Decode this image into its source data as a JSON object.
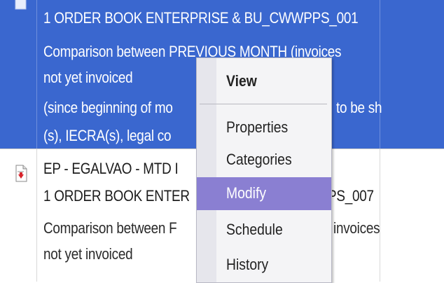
{
  "rows": [
    {
      "selected": true,
      "lines": [
        "1 ORDER BOOK ENTERPRISE & BU_CWWPPS_001",
        "Comparison between PREVIOUS MONTH (invoices",
        " not yet invoiced",
        "(since beginning of mo",
        "to be sh",
        "(s), IECRA(s), legal co"
      ]
    },
    {
      "selected": false,
      "icon": "report-document-icon",
      "lines": [
        "EP - EGALVAO - MTD I",
        "1 ORDER BOOK ENTER",
        "PS_007",
        "Comparison between F",
        "invoices",
        " not yet invoiced"
      ]
    }
  ],
  "context_menu": {
    "items": [
      {
        "label": "View",
        "bold": true
      },
      {
        "label": "Properties"
      },
      {
        "label": "Categories"
      },
      {
        "label": "Modify",
        "highlighted": true
      },
      {
        "label": "Schedule"
      },
      {
        "label": "History"
      }
    ]
  },
  "colors": {
    "selection": "#3a67cf",
    "menu_highlight": "#8a7fd2",
    "menu_background": "#f4f4f6"
  }
}
